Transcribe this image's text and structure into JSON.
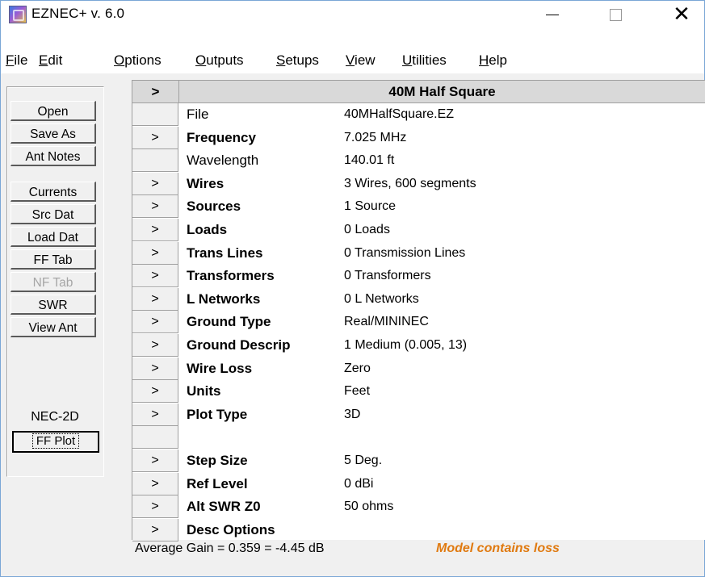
{
  "window": {
    "title": "EZNEC+  v. 6.0",
    "controls": {
      "minimize": "—",
      "maximize": "☐",
      "close": "✕"
    }
  },
  "menu": [
    {
      "label": "File"
    },
    {
      "label": "Edit"
    },
    {
      "label": "Options"
    },
    {
      "label": "Outputs"
    },
    {
      "label": "Setups"
    },
    {
      "label": "View"
    },
    {
      "label": "Utilities"
    },
    {
      "label": "Help"
    }
  ],
  "sidebar": {
    "buttons": [
      {
        "label": "Open",
        "enabled": true
      },
      {
        "label": "Save As",
        "enabled": true
      },
      {
        "label": "Ant Notes",
        "enabled": true
      },
      {
        "label": "Currents",
        "enabled": true
      },
      {
        "label": "Src Dat",
        "enabled": true
      },
      {
        "label": "Load Dat",
        "enabled": true
      },
      {
        "label": "FF Tab",
        "enabled": true
      },
      {
        "label": "NF Tab",
        "enabled": false
      },
      {
        "label": "SWR",
        "enabled": true
      },
      {
        "label": "View Ant",
        "enabled": true
      }
    ],
    "engine": "NEC-2D",
    "plot_button": "FF Plot"
  },
  "grid": {
    "header_button": ">",
    "title": "40M Half Square",
    "rows": [
      {
        "arrow": "",
        "label": "File",
        "bold": false,
        "value": "40MHalfSquare.EZ"
      },
      {
        "arrow": ">",
        "label": "Frequency",
        "bold": true,
        "value": "7.025 MHz"
      },
      {
        "arrow": "",
        "label": "Wavelength",
        "bold": false,
        "value": "140.01 ft"
      },
      {
        "arrow": ">",
        "label": "Wires",
        "bold": true,
        "value": "3 Wires, 600 segments"
      },
      {
        "arrow": ">",
        "label": "Sources",
        "bold": true,
        "value": "1 Source"
      },
      {
        "arrow": ">",
        "label": "Loads",
        "bold": true,
        "value": "0 Loads"
      },
      {
        "arrow": ">",
        "label": "Trans Lines",
        "bold": true,
        "value": "0 Transmission Lines"
      },
      {
        "arrow": ">",
        "label": "Transformers",
        "bold": true,
        "value": "0 Transformers"
      },
      {
        "arrow": ">",
        "label": "L Networks",
        "bold": true,
        "value": "0 L Networks"
      },
      {
        "arrow": ">",
        "label": "Ground Type",
        "bold": true,
        "value": "Real/MININEC"
      },
      {
        "arrow": ">",
        "label": "Ground Descrip",
        "bold": true,
        "value": "1 Medium (0.005, 13)"
      },
      {
        "arrow": ">",
        "label": "Wire Loss",
        "bold": true,
        "value": "Zero"
      },
      {
        "arrow": ">",
        "label": "Units",
        "bold": true,
        "value": "Feet"
      },
      {
        "arrow": ">",
        "label": "Plot Type",
        "bold": true,
        "value": "3D"
      },
      {
        "arrow": "",
        "label": "",
        "bold": false,
        "value": ""
      },
      {
        "arrow": ">",
        "label": "Step Size",
        "bold": true,
        "value": "5 Deg."
      },
      {
        "arrow": ">",
        "label": "Ref Level",
        "bold": true,
        "value": "0 dBi"
      },
      {
        "arrow": ">",
        "label": "Alt SWR Z0",
        "bold": true,
        "value": "50 ohms"
      },
      {
        "arrow": ">",
        "label": "Desc Options",
        "bold": true,
        "value": ""
      }
    ]
  },
  "status": {
    "gain": "Average Gain = 0.359 = -4.45 dB",
    "loss_note": "Model contains loss"
  }
}
